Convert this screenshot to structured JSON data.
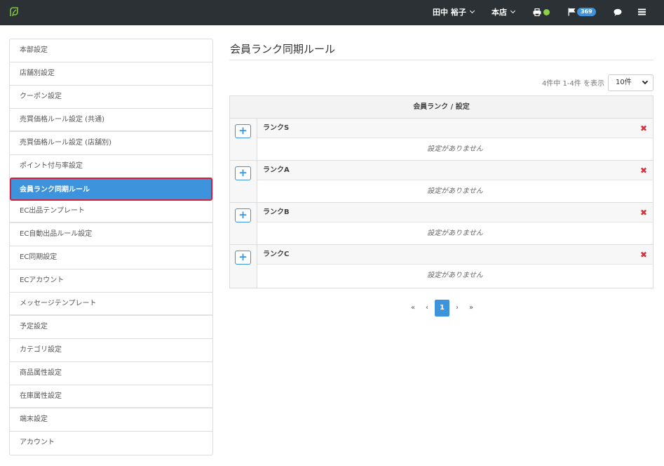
{
  "header": {
    "logo_icon": "leaf-icon",
    "user_name": "田中 裕子",
    "store_name": "本店",
    "printer_icon": "printer-icon",
    "status_color": "#8bd14a",
    "flag_icon": "flag-icon",
    "notification_count": "369",
    "chat_icon": "chat-icon",
    "menu_icon": "menu-icon"
  },
  "sidebar": {
    "items": [
      {
        "label": "本部設定"
      },
      {
        "label": "店舗別設定"
      },
      {
        "label": "クーポン設定"
      },
      {
        "label": "売買価格ルール設定 (共通)"
      },
      {
        "label": "売買価格ルール設定 (店舗別)"
      },
      {
        "label": "ポイント付与率設定"
      },
      {
        "label": "会員ランク同期ルール"
      },
      {
        "label": "EC出品テンプレート"
      },
      {
        "label": "EC自動出品ルール設定"
      },
      {
        "label": "EC同期設定"
      },
      {
        "label": "ECアカウント"
      },
      {
        "label": "メッセージテンプレート"
      },
      {
        "label": "予定設定"
      },
      {
        "label": "カテゴリ設定"
      },
      {
        "label": "商品属性設定"
      },
      {
        "label": "在庫属性設定"
      },
      {
        "label": "端末設定"
      },
      {
        "label": "アカウント"
      }
    ],
    "active_label": "会員ランク同期ルール"
  },
  "main": {
    "title": "会員ランク同期ルール",
    "count_text": "4件中 1-4件 を表示",
    "per_page": "10件",
    "table_header": "会員ランク / 設定",
    "add_symbol": "+",
    "delete_symbol": "✖",
    "ranks": [
      {
        "name": "ランクS",
        "empty": "設定がありません"
      },
      {
        "name": "ランクA",
        "empty": "設定がありません"
      },
      {
        "name": "ランクB",
        "empty": "設定がありません"
      },
      {
        "name": "ランクC",
        "empty": "設定がありません"
      }
    ]
  },
  "pagination": {
    "first": "«",
    "prev": "‹",
    "current": "1",
    "next": "›",
    "last": "»"
  },
  "colors": {
    "accent": "#3d94dc",
    "topbar": "#2b3135",
    "active_border": "#d0213f",
    "delete": "#d0343c"
  }
}
